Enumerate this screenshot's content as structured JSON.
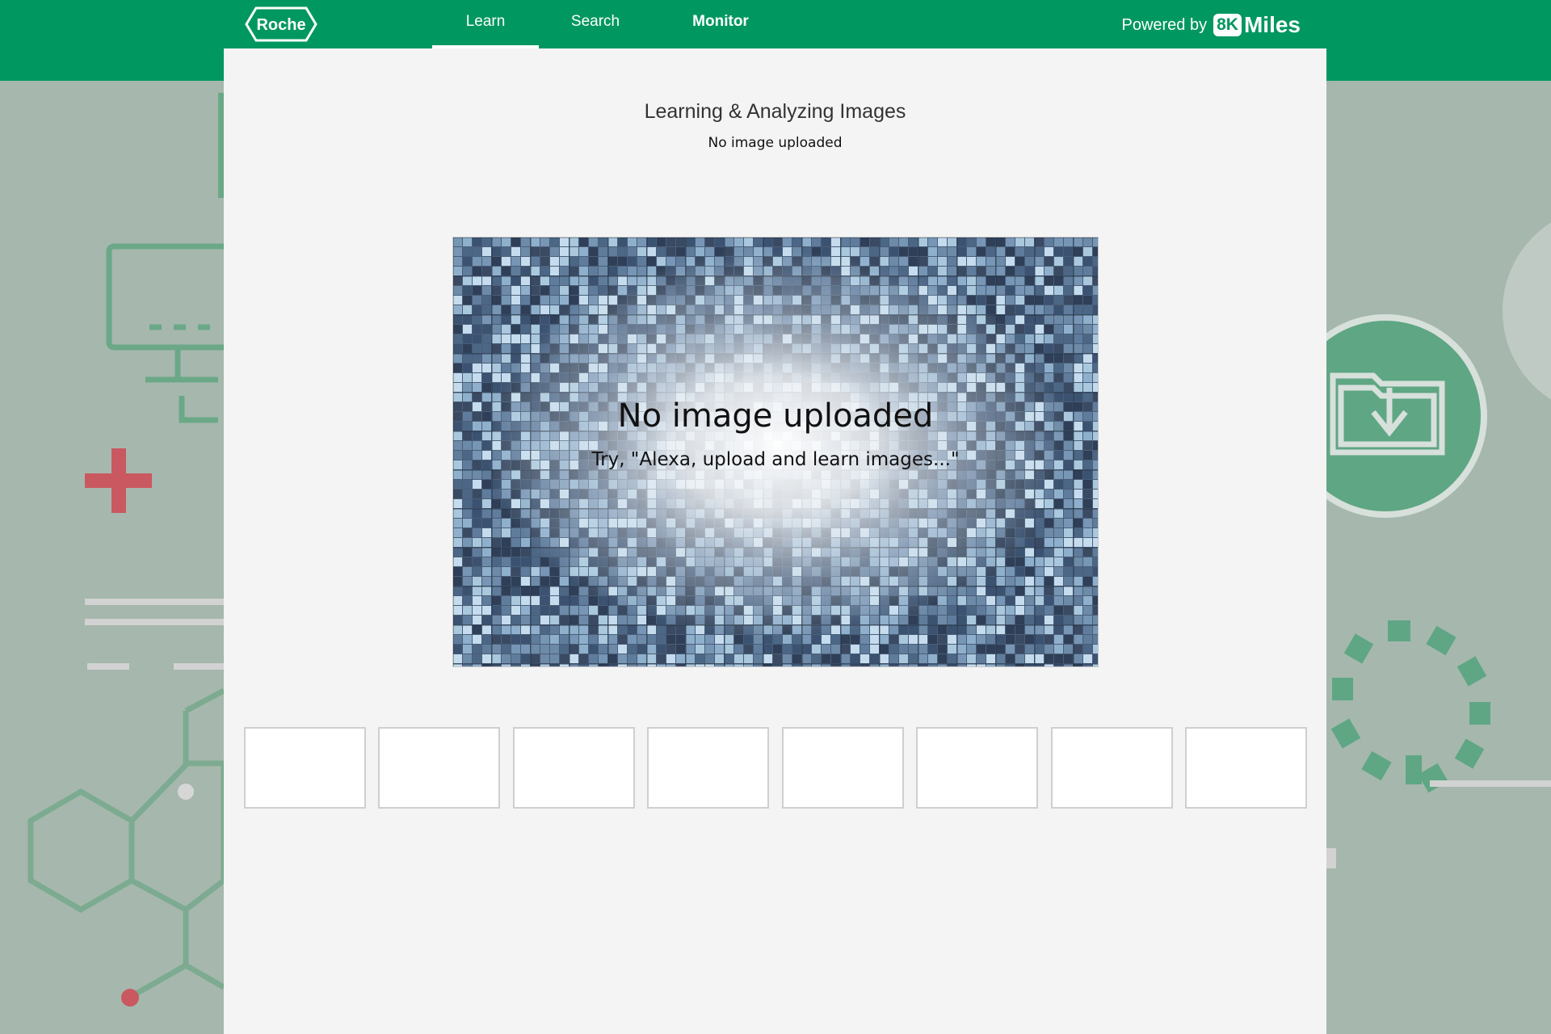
{
  "brand": {
    "logo_text": "Roche",
    "powered_by": "Powered by",
    "partner_box": "8K",
    "partner_name": "Miles"
  },
  "nav": {
    "tabs": [
      {
        "label": "Learn",
        "active": true
      },
      {
        "label": "Search",
        "active": false
      },
      {
        "label": "Monitor",
        "active": false
      }
    ]
  },
  "page": {
    "title": "Learning  & Analyzing Images",
    "subtitle": "No image uploaded"
  },
  "hero": {
    "title": "No image uploaded",
    "hint": "Try, \"Alexa, upload and learn images...\""
  },
  "thumbnails": {
    "slots": [
      "",
      "",
      "",
      "",
      "",
      "",
      "",
      ""
    ]
  },
  "colors": {
    "header_green": "#009761",
    "panel_bg": "#f4f4f4",
    "page_bg": "#a6b8ad"
  }
}
